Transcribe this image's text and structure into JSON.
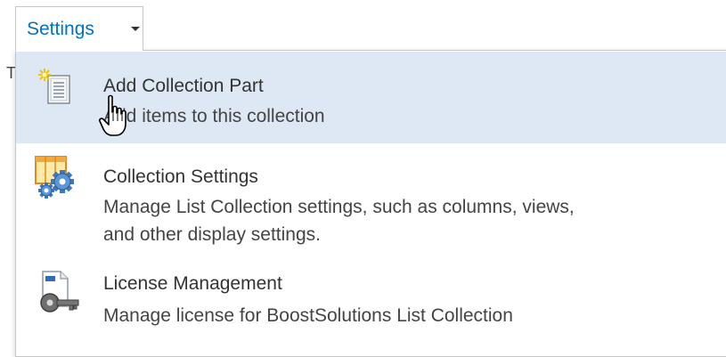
{
  "toolbar": {
    "settings_label": "Settings",
    "caret_icon": "chevron-down-icon"
  },
  "background": {
    "partial_text": "T"
  },
  "menu": {
    "items": [
      {
        "title": "Add Collection Part",
        "description": "Add items to this collection",
        "icon": "add-part-icon",
        "highlighted": true
      },
      {
        "title": "Collection Settings",
        "description_lines": [
          "Manage List Collection settings, such as columns, views,",
          "and other display settings."
        ],
        "icon": "collection-settings-gear-icon",
        "highlighted": false
      },
      {
        "title": "License Management",
        "description": "Manage license for BoostSolutions List Collection",
        "icon": "license-key-icon",
        "highlighted": false
      }
    ]
  },
  "colors": {
    "link_blue": "#0072c6",
    "highlight_bg": "#dde8f4",
    "border": "#c6c6c6"
  }
}
